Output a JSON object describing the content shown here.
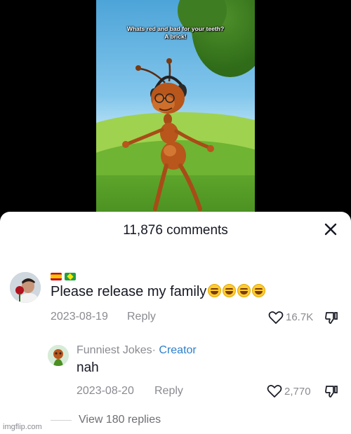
{
  "video": {
    "caption_line1": "Whats red and bad for your teeth?",
    "caption_line2": "A brick!"
  },
  "comments_panel": {
    "title": "11,876 comments",
    "close_icon": "close-icon"
  },
  "comment": {
    "flags": [
      "spain-flag",
      "brazil-flag"
    ],
    "text": "Please release my family",
    "emoji_count": 4,
    "emoji_icon": "laughing-emoji",
    "date": "2023-08-19",
    "reply_label": "Reply",
    "likes": "16.7K"
  },
  "reply": {
    "author": "Funniest Jokes",
    "separator": "·",
    "badge": "Creator",
    "text": "nah",
    "date": "2023-08-20",
    "reply_label": "Reply",
    "likes": "2,770"
  },
  "view_replies": "View 180 replies",
  "watermark": "imgflip.com",
  "colors": {
    "creator_badge": "#2c7fc9",
    "meta_text": "#8a8b91",
    "primary_text": "#161823"
  }
}
